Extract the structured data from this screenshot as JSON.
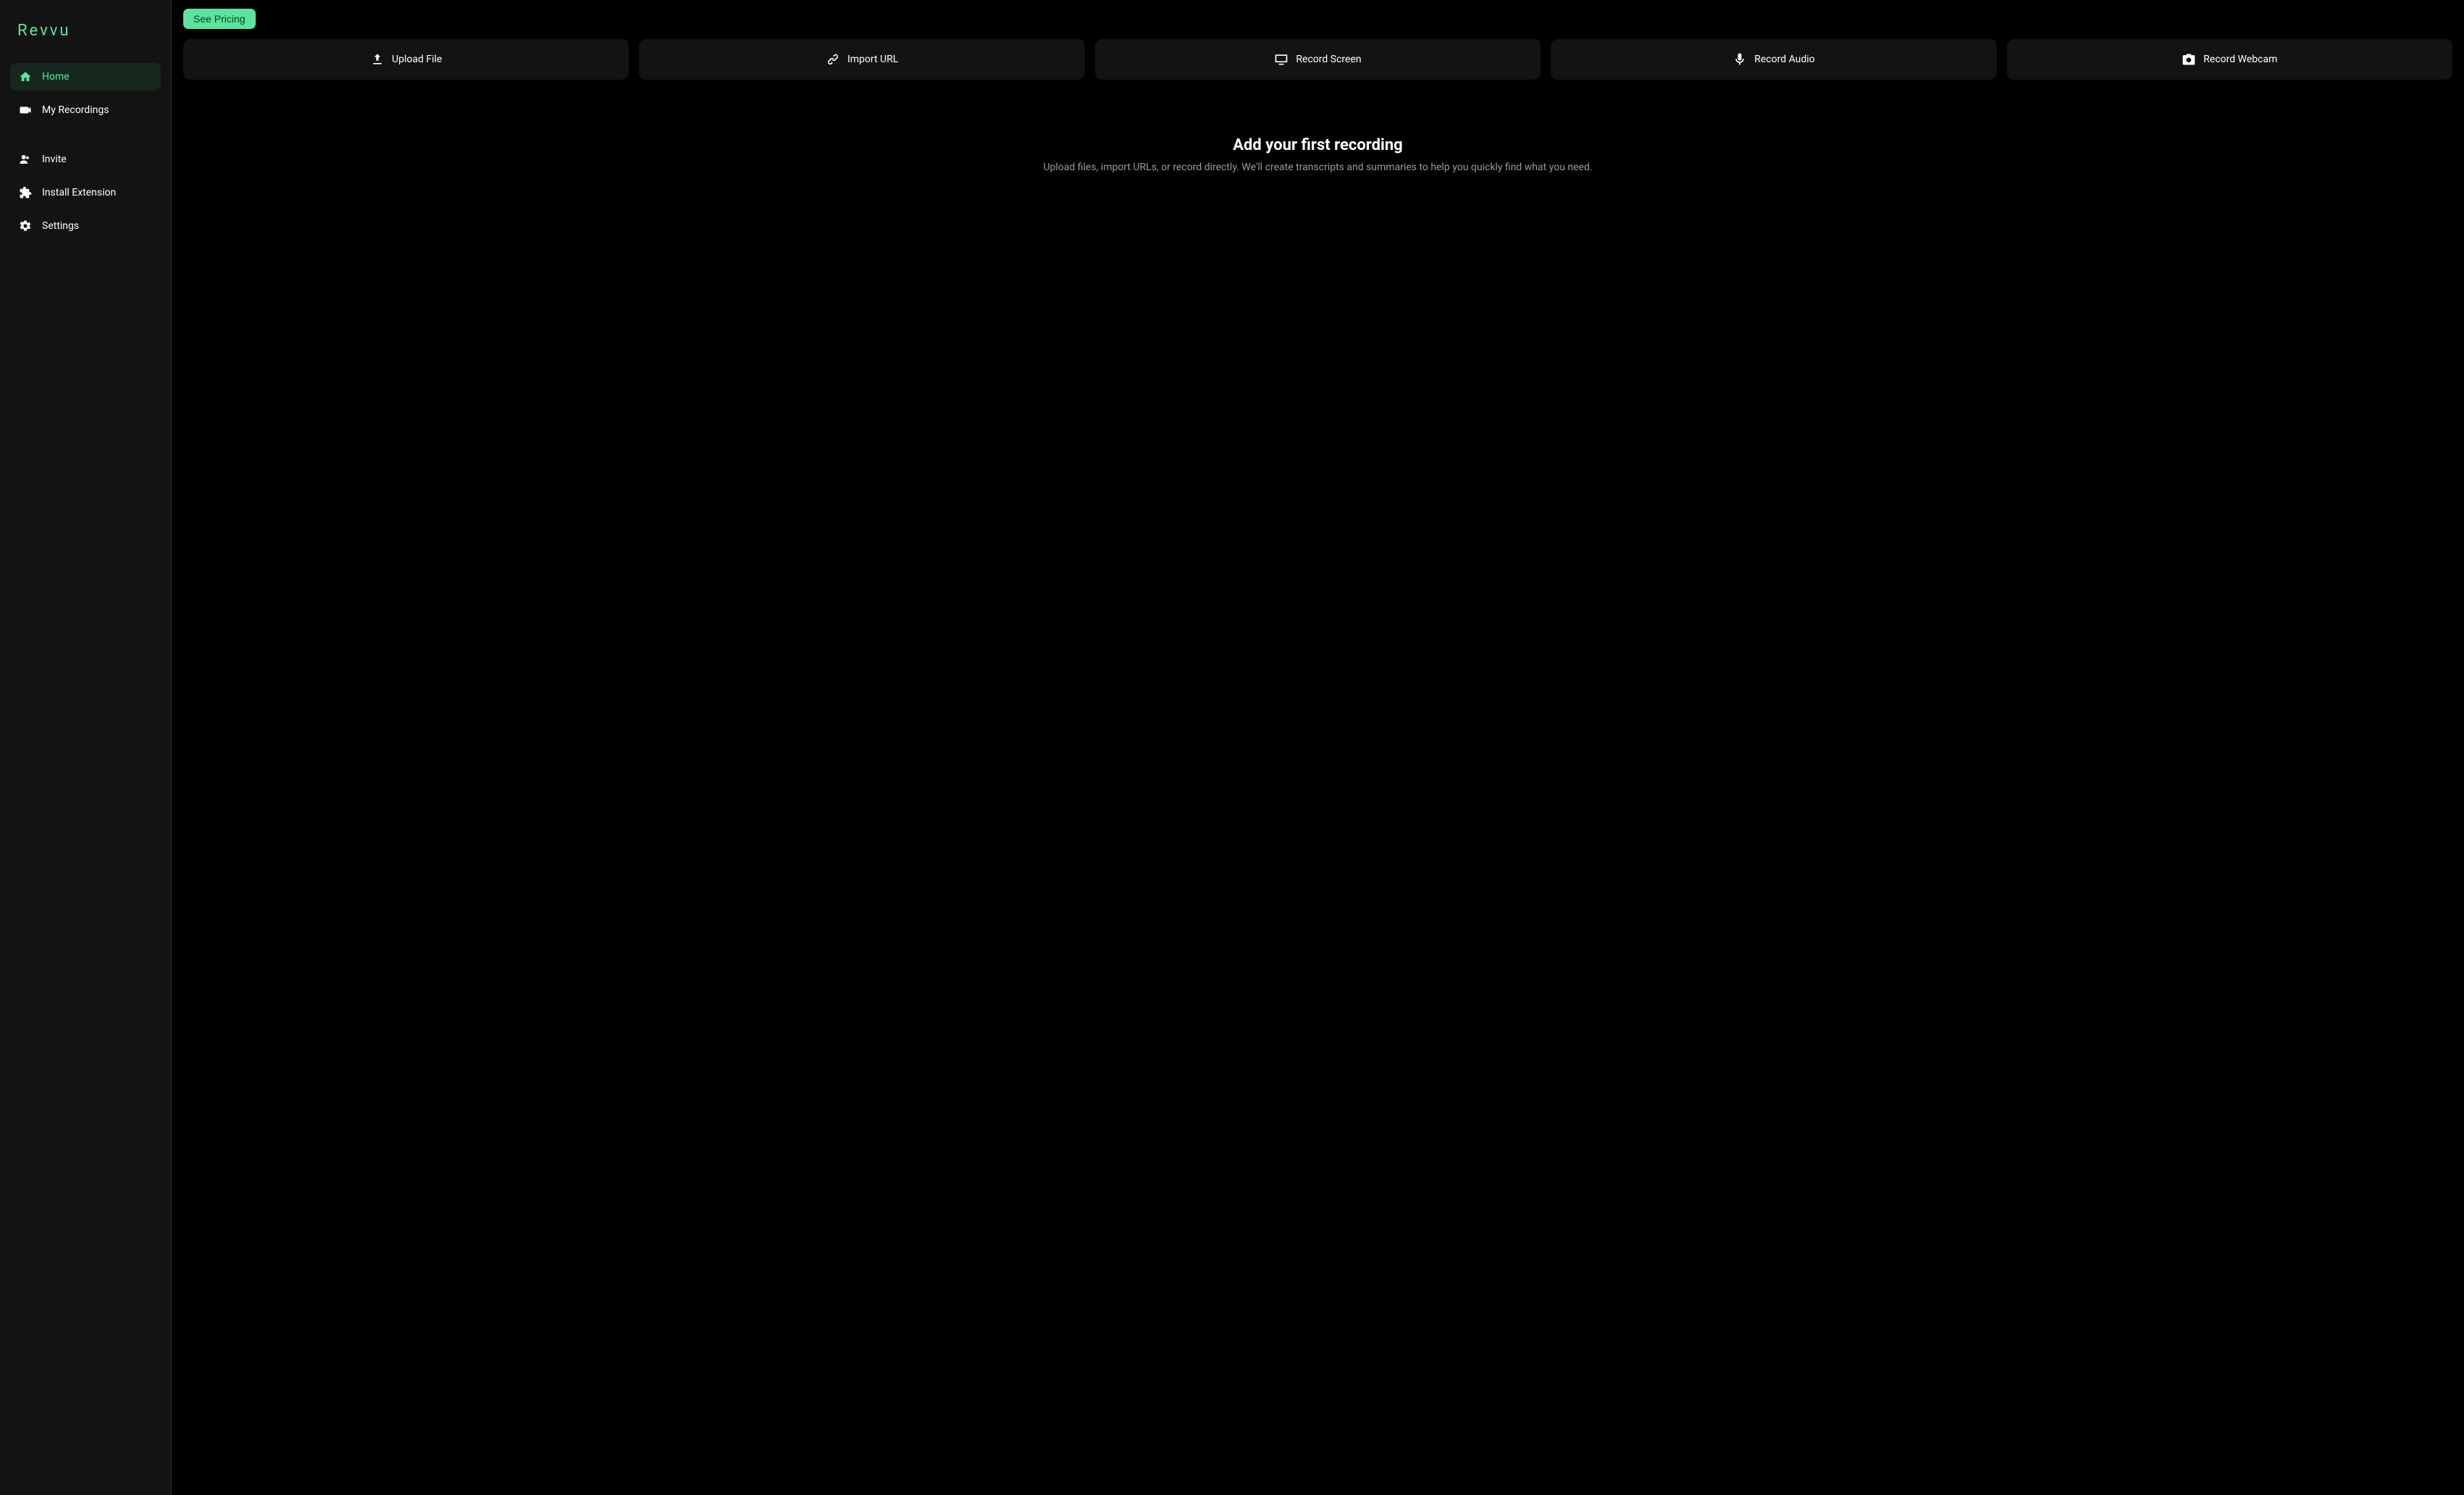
{
  "app": {
    "name": "Revvu"
  },
  "sidebar": {
    "items": [
      {
        "label": "Home",
        "icon": "home-icon",
        "active": true
      },
      {
        "label": "My Recordings",
        "icon": "video-icon",
        "active": false
      },
      {
        "label": "Invite",
        "icon": "invite-icon",
        "active": false
      },
      {
        "label": "Install Extension",
        "icon": "puzzle-icon",
        "active": false
      },
      {
        "label": "Settings",
        "icon": "gear-icon",
        "active": false
      }
    ]
  },
  "header": {
    "pricing_button_label": "See Pricing"
  },
  "actions": [
    {
      "label": "Upload File",
      "icon": "upload-icon"
    },
    {
      "label": "Import URL",
      "icon": "link-icon"
    },
    {
      "label": "Record Screen",
      "icon": "screen-icon"
    },
    {
      "label": "Record Audio",
      "icon": "mic-icon"
    },
    {
      "label": "Record Webcam",
      "icon": "camera-icon"
    }
  ],
  "empty_state": {
    "title": "Add your first recording",
    "subtitle": "Upload files, import URLs, or record directly. We'll create transcripts and summaries to help you quickly find what you need."
  }
}
